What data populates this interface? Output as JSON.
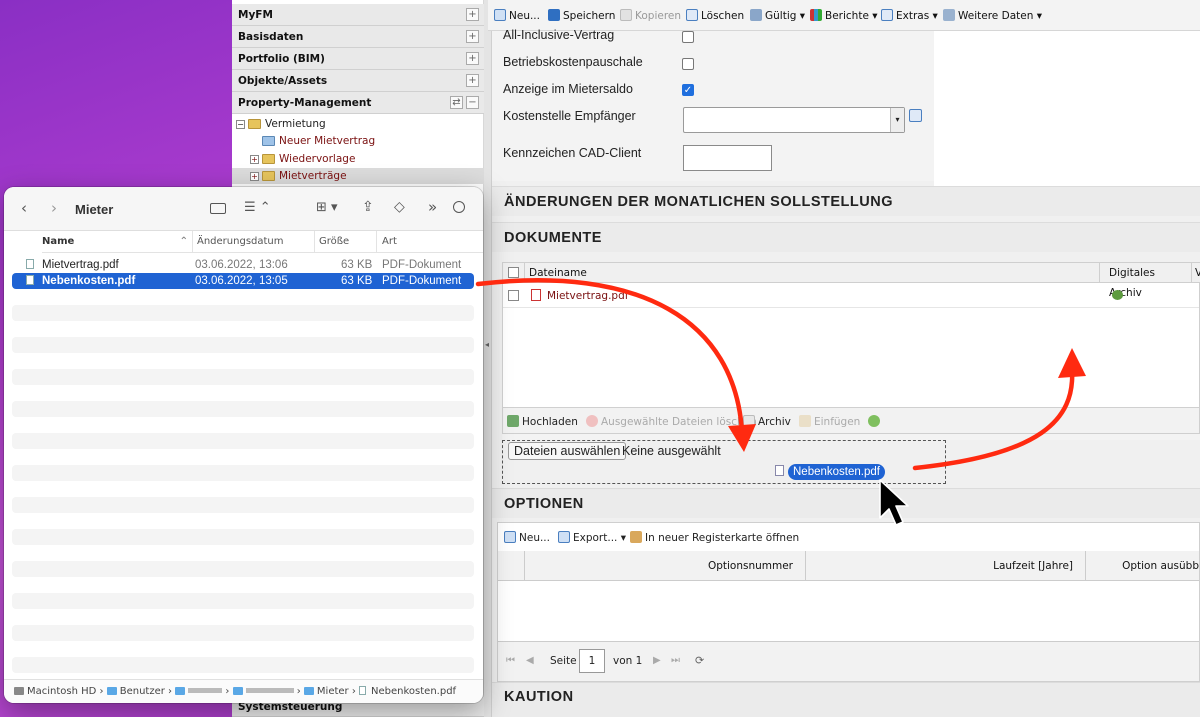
{
  "nav": {
    "sections": [
      "MyFM",
      "Basisdaten",
      "Portfolio (BIM)",
      "Objekte/Assets",
      "Property-Management"
    ],
    "bottom_section": "Systemsteuerung",
    "tree": [
      "Vermietung",
      "Neuer Mietvertrag",
      "Wiedervorlage",
      "Mietverträge"
    ]
  },
  "toolbar": {
    "items": [
      "Neu...",
      "Speichern",
      "Kopieren",
      "Löschen",
      "Gültig",
      "Berichte",
      "Extras",
      "Weitere Daten"
    ]
  },
  "form": {
    "fields": [
      {
        "label": "All-Inclusive-Vertrag",
        "checked": false
      },
      {
        "label": "Betriebskostenpauschale",
        "checked": false
      },
      {
        "label": "Anzeige im Mietersaldo",
        "checked": true
      }
    ],
    "kostenstelle_label": "Kostenstelle Empfänger",
    "cad_label": "Kennzeichen CAD-Client"
  },
  "sections": {
    "aenderungen": "ÄNDERUNGEN DER MONATLICHEN SOLLSTELLUNG",
    "dokumente": "DOKUMENTE",
    "optionen": "OPTIONEN",
    "kaution": "KAUTION"
  },
  "documents": {
    "col_dateiname": "Dateiname",
    "col_archiv": "Digitales Archiv",
    "col_extra": "V",
    "rows": [
      {
        "name": "Mietvertrag.pdf"
      }
    ],
    "buttons": [
      "Hochladen",
      "Ausgewählte Dateien löschen",
      "Archiv",
      "Einfügen"
    ]
  },
  "upload": {
    "button": "Dateien auswählen",
    "status": "Keine ausgewählt",
    "dragged_file": "Nebenkosten.pdf"
  },
  "options": {
    "buttons": [
      "Neu...",
      "Export...",
      "In neuer Registerkarte öffnen"
    ],
    "columns": [
      "Optionsnummer",
      "Laufzeit [Jahre]",
      "Option ausübb"
    ],
    "pager": {
      "page_label": "Seite",
      "page_value": "1",
      "of_label": "von 1"
    }
  },
  "finder": {
    "title": "Mieter",
    "columns": [
      "Name",
      "Änderungsdatum",
      "Größe",
      "Art"
    ],
    "files": [
      {
        "name": "Mietvertrag.pdf",
        "date": "03.06.2022, 13:06",
        "size": "63 KB",
        "kind": "PDF-Dokument",
        "selected": false
      },
      {
        "name": "Nebenkosten.pdf",
        "date": "03.06.2022, 13:05",
        "size": "63 KB",
        "kind": "PDF-Dokument",
        "selected": true
      }
    ],
    "path": [
      "Macintosh HD",
      "Benutzer",
      "Mieter",
      "Nebenkosten.pdf"
    ]
  },
  "colors": {
    "arrow": "#ff2a10",
    "selection": "#1f63d3",
    "maroon": "#7a1010"
  }
}
